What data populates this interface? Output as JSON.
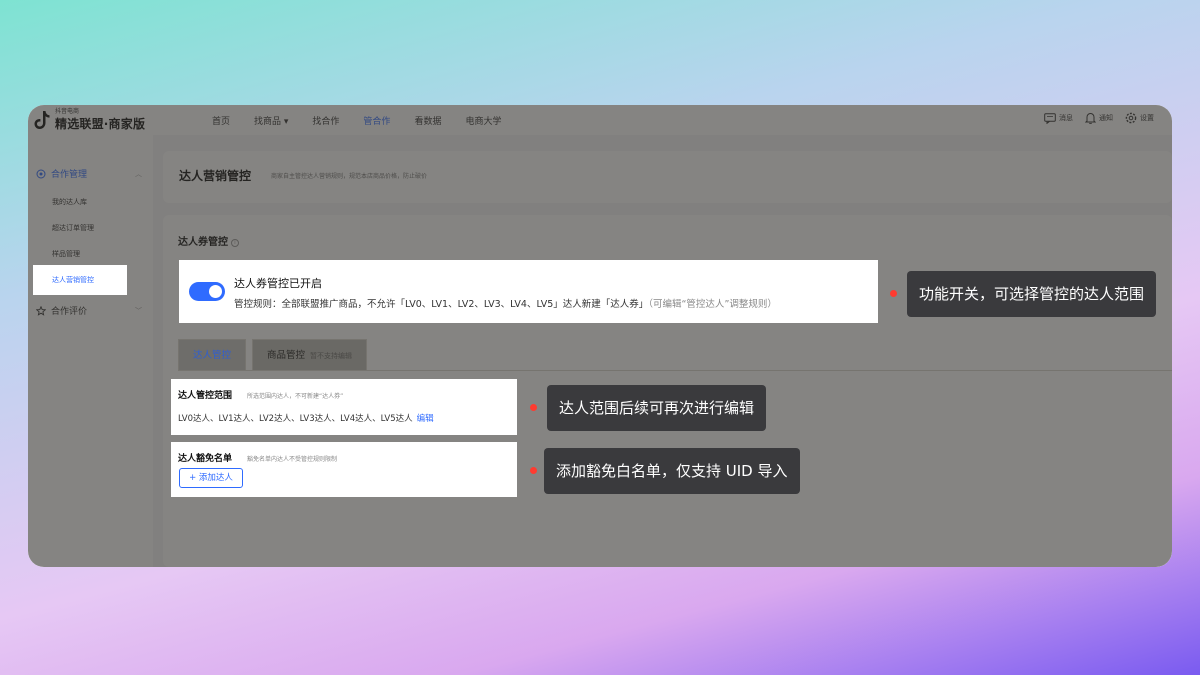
{
  "app": {
    "logo_small": "抖音电商",
    "logo_text": "精选联盟·商家版"
  },
  "nav": {
    "items": [
      "首页",
      "找商品 ▾",
      "找合作",
      "管合作",
      "看数据",
      "电商大学"
    ],
    "active_index": 3
  },
  "nav_right": {
    "messages": "消息",
    "notifications": "通知",
    "settings": "设置"
  },
  "sidebar": {
    "group1": "合作管理",
    "group1_items": [
      "我的达人库",
      "超达订单管理",
      "样品管理",
      "达人营销管控"
    ],
    "active_item": "达人营销管控",
    "group2": "合作评价"
  },
  "header": {
    "title": "达人营销管控",
    "description": "商家自主管控达人营销规则，规范本店商品价格，防止破价"
  },
  "section": {
    "title": "达人券管控",
    "info_icon": "i"
  },
  "toggle_panel": {
    "enabled": true,
    "title": "达人券管控已开启",
    "rule": "管控规则：全部联盟推广商品，不允许「LV0、LV1、LV2、LV3、LV4、LV5」达人新建「达人券」",
    "rule_hint": "（可编辑“管控达人”调整规则）"
  },
  "tabs": [
    {
      "label": "达人管控",
      "hint": ""
    },
    {
      "label": "商品管控",
      "hint": "暂不支持编辑"
    }
  ],
  "scope": {
    "title": "达人管控范围",
    "description": "所选范围内达人，不可新建“达人券”",
    "value": "LV0达人、LV1达人、LV2达人、LV3达人、LV4达人、LV5达人",
    "edit": "编辑"
  },
  "exempt": {
    "title": "达人豁免名单",
    "description": "豁免名单内达人不受管控规则限制",
    "add_button": "+ 添加达人"
  },
  "callouts": {
    "toggle": "功能开关，可选择管控的达人范围",
    "scope": "达人范围后续可再次进行编辑",
    "exempt": "添加豁免白名单，仅支持 UID 导入"
  },
  "colors": {
    "accent": "#2f6bff",
    "callout_bg": "#3a3a3d",
    "dot": "#ff3b30"
  }
}
